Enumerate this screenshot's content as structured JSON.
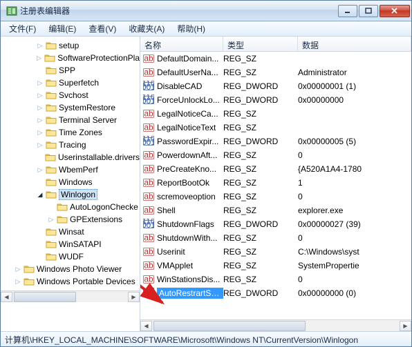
{
  "window": {
    "title": "注册表编辑器"
  },
  "menu": {
    "file": "文件(F)",
    "edit": "编辑(E)",
    "view": "查看(V)",
    "favorites": "收藏夹(A)",
    "help": "帮助(H)"
  },
  "columns": {
    "name": "名称",
    "type": "类型",
    "data": "数据"
  },
  "tree": [
    {
      "depth": 3,
      "exp": "▷",
      "label": "setup"
    },
    {
      "depth": 3,
      "exp": "▷",
      "label": "SoftwareProtectionPla"
    },
    {
      "depth": 3,
      "exp": "",
      "label": "SPP"
    },
    {
      "depth": 3,
      "exp": "▷",
      "label": "Superfetch"
    },
    {
      "depth": 3,
      "exp": "▷",
      "label": "Svchost"
    },
    {
      "depth": 3,
      "exp": "▷",
      "label": "SystemRestore"
    },
    {
      "depth": 3,
      "exp": "▷",
      "label": "Terminal Server"
    },
    {
      "depth": 3,
      "exp": "▷",
      "label": "Time Zones"
    },
    {
      "depth": 3,
      "exp": "▷",
      "label": "Tracing"
    },
    {
      "depth": 3,
      "exp": "",
      "label": "Userinstallable.drivers"
    },
    {
      "depth": 3,
      "exp": "▷",
      "label": "WbemPerf"
    },
    {
      "depth": 3,
      "exp": "",
      "label": "Windows"
    },
    {
      "depth": 3,
      "exp": "◢",
      "label": "Winlogon",
      "selected": true
    },
    {
      "depth": 4,
      "exp": "",
      "label": "AutoLogonChecke"
    },
    {
      "depth": 4,
      "exp": "▷",
      "label": "GPExtensions"
    },
    {
      "depth": 3,
      "exp": "",
      "label": "Winsat"
    },
    {
      "depth": 3,
      "exp": "",
      "label": "WinSATAPI"
    },
    {
      "depth": 3,
      "exp": "",
      "label": "WUDF"
    },
    {
      "depth": 1,
      "exp": "▷",
      "label": "Windows Photo Viewer"
    },
    {
      "depth": 1,
      "exp": "▷",
      "label": "Windows Portable Devices"
    }
  ],
  "values": [
    {
      "icon": "sz",
      "name": "DefaultDomain...",
      "type": "REG_SZ",
      "data": ""
    },
    {
      "icon": "sz",
      "name": "DefaultUserNa...",
      "type": "REG_SZ",
      "data": "Administrator"
    },
    {
      "icon": "dw",
      "name": "DisableCAD",
      "type": "REG_DWORD",
      "data": "0x00000001 (1)"
    },
    {
      "icon": "dw",
      "name": "ForceUnlockLo...",
      "type": "REG_DWORD",
      "data": "0x00000000"
    },
    {
      "icon": "sz",
      "name": "LegalNoticeCa...",
      "type": "REG_SZ",
      "data": ""
    },
    {
      "icon": "sz",
      "name": "LegalNoticeText",
      "type": "REG_SZ",
      "data": ""
    },
    {
      "icon": "dw",
      "name": "PasswordExpir...",
      "type": "REG_DWORD",
      "data": "0x00000005 (5)"
    },
    {
      "icon": "sz",
      "name": "PowerdownAft...",
      "type": "REG_SZ",
      "data": "0"
    },
    {
      "icon": "sz",
      "name": "PreCreateKno...",
      "type": "REG_SZ",
      "data": "{A520A1A4-1780"
    },
    {
      "icon": "sz",
      "name": "ReportBootOk",
      "type": "REG_SZ",
      "data": "1"
    },
    {
      "icon": "sz",
      "name": "scremoveoption",
      "type": "REG_SZ",
      "data": "0"
    },
    {
      "icon": "sz",
      "name": "Shell",
      "type": "REG_SZ",
      "data": "explorer.exe"
    },
    {
      "icon": "dw",
      "name": "ShutdownFlags",
      "type": "REG_DWORD",
      "data": "0x00000027 (39)"
    },
    {
      "icon": "sz",
      "name": "ShutdownWith...",
      "type": "REG_SZ",
      "data": "0"
    },
    {
      "icon": "sz",
      "name": "Userinit",
      "type": "REG_SZ",
      "data": "C:\\Windows\\syst"
    },
    {
      "icon": "sz",
      "name": "VMApplet",
      "type": "REG_SZ",
      "data": "SystemPropertie"
    },
    {
      "icon": "sz",
      "name": "WinStationsDis...",
      "type": "REG_SZ",
      "data": "0"
    },
    {
      "icon": "dw",
      "name": "AutoRestrartSh...",
      "type": "REG_DWORD",
      "data": "0x00000000 (0)",
      "selected": true
    }
  ],
  "statusbar": "计算机\\HKEY_LOCAL_MACHINE\\SOFTWARE\\Microsoft\\Windows NT\\CurrentVersion\\Winlogon"
}
